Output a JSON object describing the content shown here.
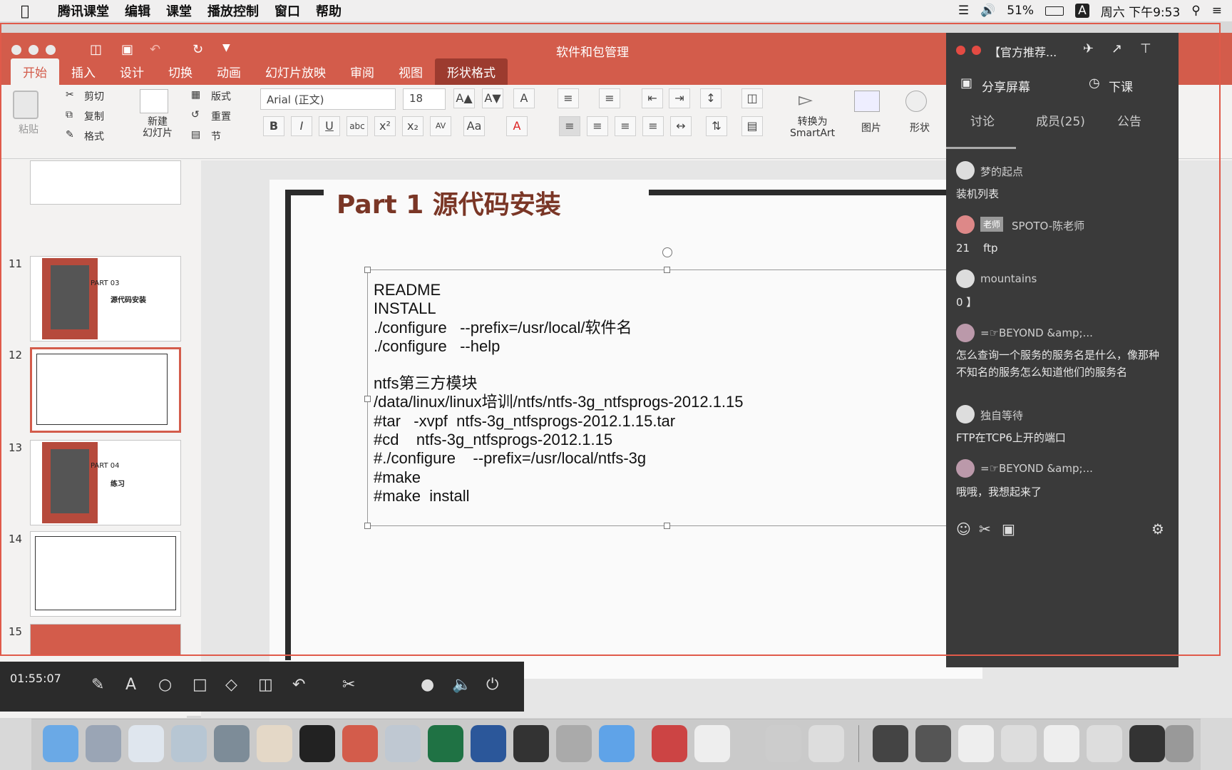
{
  "menubar": {
    "items": [
      "腾讯课堂",
      "编辑",
      "课堂",
      "播放控制",
      "窗口",
      "帮助"
    ],
    "battery": "51%",
    "clock": "周六 下午9:53",
    "input": "A"
  },
  "ppt": {
    "title": "软件和包管理",
    "tabs": [
      "开始",
      "插入",
      "设计",
      "切换",
      "动画",
      "幻灯片放映",
      "审阅",
      "视图",
      "形状格式"
    ],
    "ribbon": {
      "paste": "粘贴",
      "cut": "剪切",
      "copy": "复制",
      "format": "格式",
      "new_slide": "新建\n幻灯片",
      "layout": "版式",
      "reset": "重置",
      "section": "节",
      "font": "Arial (正文)",
      "size": "18",
      "smartart": "转换为\nSmartArt",
      "picture": "图片",
      "shape": "形状"
    },
    "slides": [
      {
        "num": "11",
        "part": "PART 03",
        "title": "源代码安装"
      },
      {
        "num": "12"
      },
      {
        "num": "13",
        "part": "PART 04",
        "title": "练习"
      },
      {
        "num": "14"
      },
      {
        "num": "15"
      }
    ],
    "slide": {
      "heading": "Part 1 源代码安装",
      "lines": [
        "README",
        "INSTALL",
        "./configure   --prefix=/usr/local/软件名",
        "./configure   --help",
        "",
        "ntfs第三方模块",
        "/data/linux/linux培训/ntfs/ntfs-3g_ntfsprogs-2012.1.15",
        "#tar   -xvpf  ntfs-3g_ntfsprogs-2012.1.15.tar",
        "#cd    ntfs-3g_ntfsprogs-2012.1.15",
        "#./configure    --prefix=/usr/local/ntfs-3g",
        "#make",
        "#make  install"
      ]
    }
  },
  "chat": {
    "header": "【官方推荐...",
    "share": "分享屏幕",
    "end": "下课",
    "tabs": [
      "讨论",
      "成员(25)",
      "公告"
    ],
    "messages": [
      {
        "name": "梦的起点",
        "text": "装机列表"
      },
      {
        "badge": "老师",
        "name": "SPOTO-陈老师",
        "text": "21    ftp"
      },
      {
        "name": "mountains",
        "text": "0 】"
      },
      {
        "name": "=☞BEYOND &amp;...",
        "text": "怎么查询一个服务的服务名是什么，像那种不知名的服务怎么知道他们的服务名"
      },
      {
        "name": "独自等待",
        "text": "FTP在TCP6上开的端口"
      },
      {
        "name": "=☞BEYOND &amp;...",
        "text": "哦哦，我想起来了"
      }
    ]
  },
  "recorder": {
    "time": "01:55:07"
  },
  "colors": {
    "accent": "#d35c4b",
    "chat_bg": "#3a3a3a",
    "slide_title": "#7a3626"
  }
}
